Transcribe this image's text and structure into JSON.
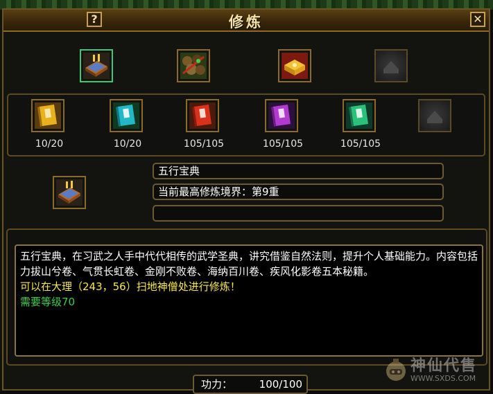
{
  "window": {
    "title": "修炼",
    "help_label": "?",
    "close_label": "✕"
  },
  "top_slots": [
    {
      "icon": "wuxing-book-icon",
      "selected": true
    },
    {
      "icon": "scroll-bundle-icon"
    },
    {
      "icon": "golden-chest-icon"
    },
    {
      "icon": "empty-slot"
    }
  ],
  "manuals": [
    {
      "icon": "yellow-manual-icon",
      "color": "#e8b21e",
      "progress": "10/20"
    },
    {
      "icon": "cyan-manual-icon",
      "color": "#22b8c8",
      "progress": "10/20"
    },
    {
      "icon": "red-manual-icon",
      "color": "#d8321c",
      "progress": "105/105"
    },
    {
      "icon": "purple-manual-icon",
      "color": "#b33ad0",
      "progress": "105/105"
    },
    {
      "icon": "green-manual-icon",
      "color": "#2ac27a",
      "progress": "105/105"
    },
    {
      "icon": "empty-slot"
    }
  ],
  "selected_item": {
    "icon": "wuxing-book-icon",
    "name": "五行宝典",
    "realm": "当前最高修炼境界：第9重",
    "extra": ""
  },
  "description": {
    "text": "五行宝典，在习武之人手中代代相传的武学圣典，讲究借鉴自然法则，提升个人基础能力。内容包括力拔山兮卷、气贯长虹卷、金刚不败卷、海纳百川卷、疾风化影卷五本秘籍。",
    "location": "可以在大理（243，56）扫地神僧处进行修炼！",
    "requirement": "需要等级70"
  },
  "power": {
    "label": "功力：",
    "value": "100/100"
  },
  "watermark": {
    "title": "神仙代售",
    "url": "WWW.SXDS.COM"
  }
}
